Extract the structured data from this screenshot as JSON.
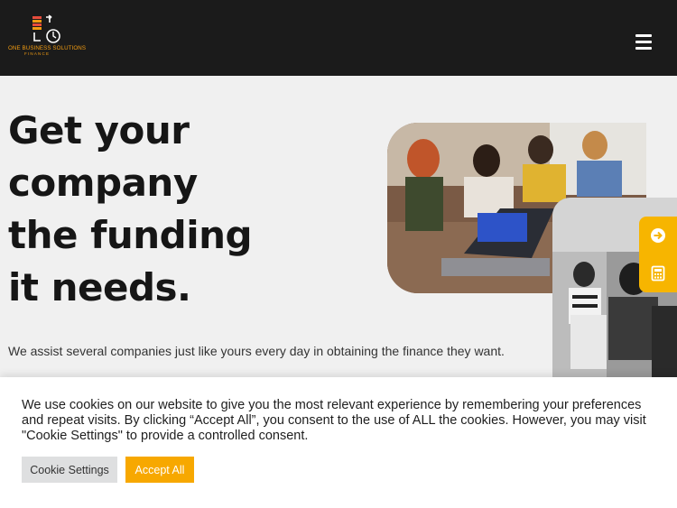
{
  "header": {
    "logo_text": "ONE BUSINESS SOLUTIONS",
    "logo_subtext": "FINANCE",
    "menu_icon": "hamburger-menu-icon"
  },
  "hero": {
    "title": "Get your company the funding it needs.",
    "subtitle": "We assist several companies just like yours every day in obtaining the finance they want."
  },
  "side_tab": {
    "icons": [
      "arrow-right-circle-icon",
      "calculator-icon"
    ]
  },
  "cookie_banner": {
    "text": "We use cookies on our website to give you the most relevant experience by remembering your preferences and repeat visits. By clicking “Accept All”, you consent to the use of ALL the cookies. However, you may visit \"Cookie Settings\" to provide a controlled consent.",
    "settings_label": "Cookie Settings",
    "accept_label": "Accept All"
  },
  "colors": {
    "header_bg": "#1b1b1b",
    "accent": "#f7b500",
    "accept_button": "#f7a800"
  }
}
